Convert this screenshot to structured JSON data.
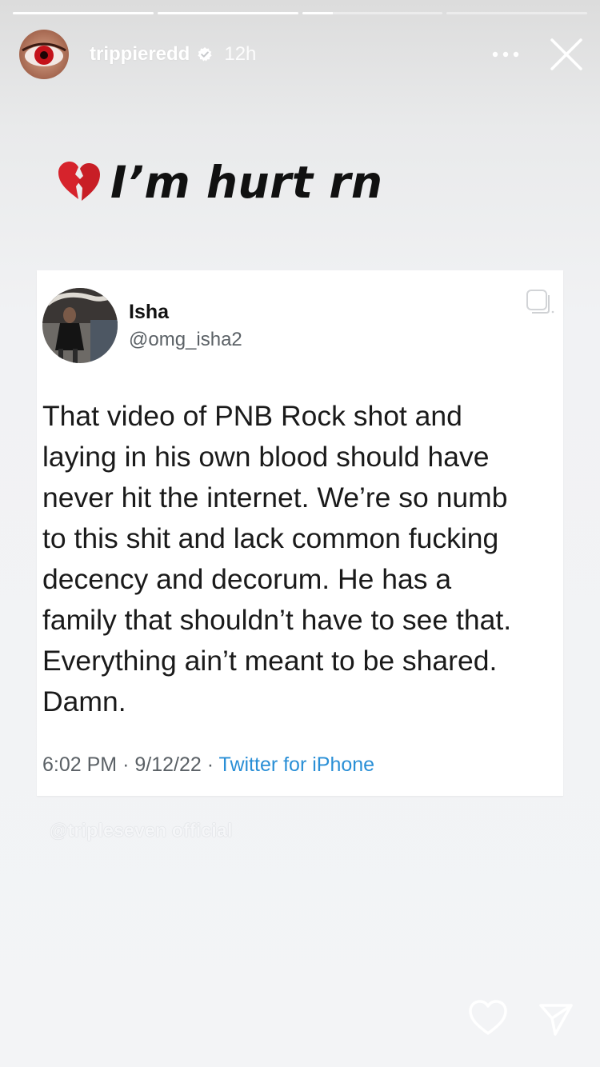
{
  "story": {
    "progress": [
      1,
      1,
      0.22,
      0,
      0
    ],
    "username": "trippieredd",
    "time_ago": "12h",
    "caption_emoji": "broken-heart-emoji",
    "caption_text": "I’m hurt rn",
    "watermark": "@tripleseven official"
  },
  "tweet": {
    "name": "Isha",
    "handle": "@omg_isha2",
    "body_lines": [
      "That video of PNB Rock shot and",
      "laying in his own blood should have",
      "never hit the internet. We’re so numb",
      "to this shit and lack common fucking",
      "decency and decorum. He has a",
      "family that shouldn’t have to see that.",
      "Everything ain’t meant to be shared.",
      "Damn."
    ],
    "time": "6:02 PM",
    "date": "9/12/22",
    "source": "Twitter for iPhone",
    "separator": "·"
  },
  "icons": {
    "verified": "verified-badge-icon",
    "more": "more-options-icon",
    "close": "close-icon",
    "copy": "copy-icon",
    "like": "heart-icon",
    "share": "send-icon"
  },
  "colors": {
    "link": "#2a8fd6",
    "eye_red": "#c4121a"
  }
}
